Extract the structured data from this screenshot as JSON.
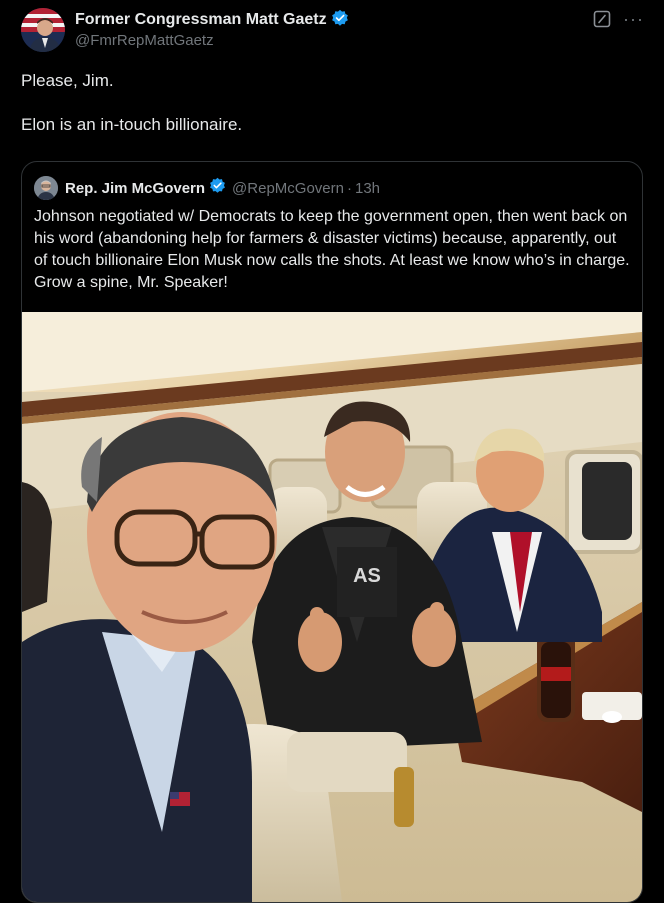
{
  "post": {
    "author_name": "Former Congressman Matt Gaetz",
    "author_handle": "@FmrRepMattGaetz",
    "verified_icon": "verified-badge-icon",
    "text_lines": [
      "Please, Jim.",
      "Elon is an in-touch billionaire."
    ]
  },
  "top_actions": {
    "grok_icon": "grok-icon",
    "more_label": "···"
  },
  "quote": {
    "author_name": "Rep. Jim McGovern",
    "author_handle": "@RepMcGovern",
    "separator": "·",
    "time": "13h",
    "text": "Johnson negotiated w/ Democrats to keep the government open, then went back on his word (abandoning help for farmers & disaster victims) because, apparently, out of touch billionaire Elon Musk now calls the shots. At least we know who’s in charge. Grow a spine, Mr. Speaker!",
    "media_description_icon": "photo"
  },
  "colors": {
    "background": "#000000",
    "text_primary": "#e7e9ea",
    "text_secondary": "#71767b",
    "border": "#2f3336",
    "verified_blue": "#1d9bf0"
  }
}
